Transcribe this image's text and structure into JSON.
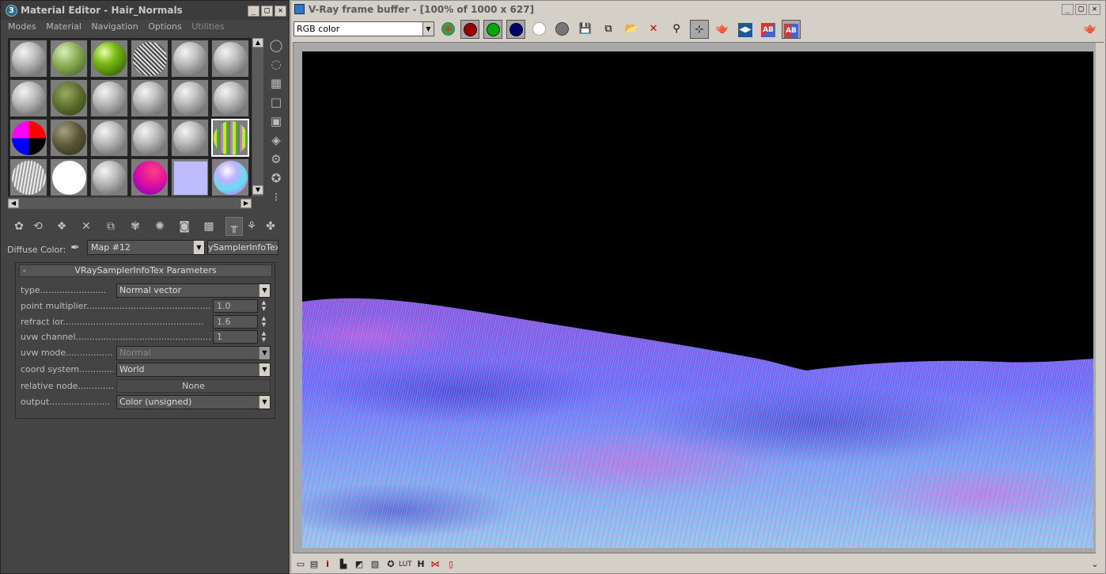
{
  "material_editor": {
    "title": "Material Editor - Hair_Normals",
    "menu": [
      "Modes",
      "Material",
      "Navigation",
      "Options",
      "Utilities"
    ],
    "diffuse_label": "Diffuse Color:",
    "map_name": "Map #12",
    "map_type": "ySamplerInfoTex",
    "rollout": {
      "title": "VRaySamplerInfoTex Parameters",
      "collapse": "-",
      "params": {
        "type": {
          "label": "type........................",
          "value": "Normal vector"
        },
        "point_multiplier": {
          "label": "point multiplier..............................................",
          "value": "1.0"
        },
        "refract_ior": {
          "label": "refract ior...................................................",
          "value": "1.6"
        },
        "uvw_channel": {
          "label": "uvw channel.................................................",
          "value": "1"
        },
        "uvw_mode": {
          "label": "uvw mode.................",
          "value": "Normal"
        },
        "coord_system": {
          "label": "coord system.............",
          "value": "World"
        },
        "relative_node": {
          "label": "relative node.............",
          "value": "None"
        },
        "output": {
          "label": "output......................",
          "value": "Color (unsigned)"
        }
      }
    }
  },
  "vfb": {
    "title": "V-Ray frame buffer - [100% of 1000 x 627]",
    "channel": "RGB color"
  },
  "window_buttons": {
    "minimize": "_",
    "restore": "□",
    "close": "✕"
  }
}
